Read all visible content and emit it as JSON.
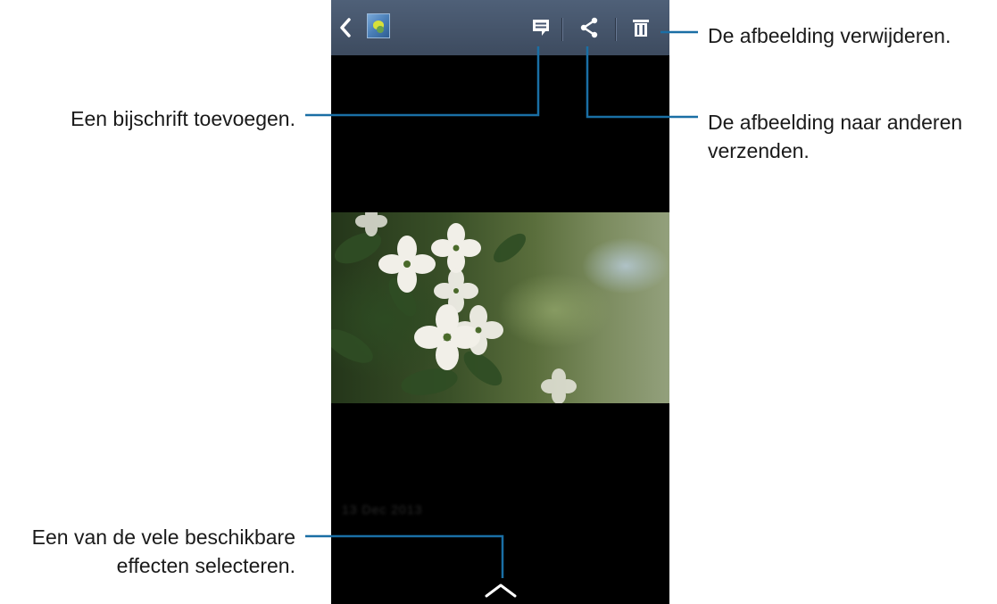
{
  "screen": {
    "date_label": "13 Dec 2013",
    "accent_color": "#1a6fa5",
    "actionbar_color": "#465670"
  },
  "toolbar": {
    "back_icon": "chevron-left-icon",
    "album_icon": "album-thumbnail",
    "caption_icon": "caption-icon",
    "share_icon": "share-icon",
    "delete_icon": "trash-icon",
    "expand_icon": "chevron-up-icon"
  },
  "callouts": {
    "caption": "Een bijschrift toevoegen.",
    "delete": "De afbeelding verwijderen.",
    "share_line1": "De afbeelding naar anderen",
    "share_line2": "verzenden.",
    "effects_line1": "Een van de vele beschikbare",
    "effects_line2": "effecten selecteren."
  }
}
